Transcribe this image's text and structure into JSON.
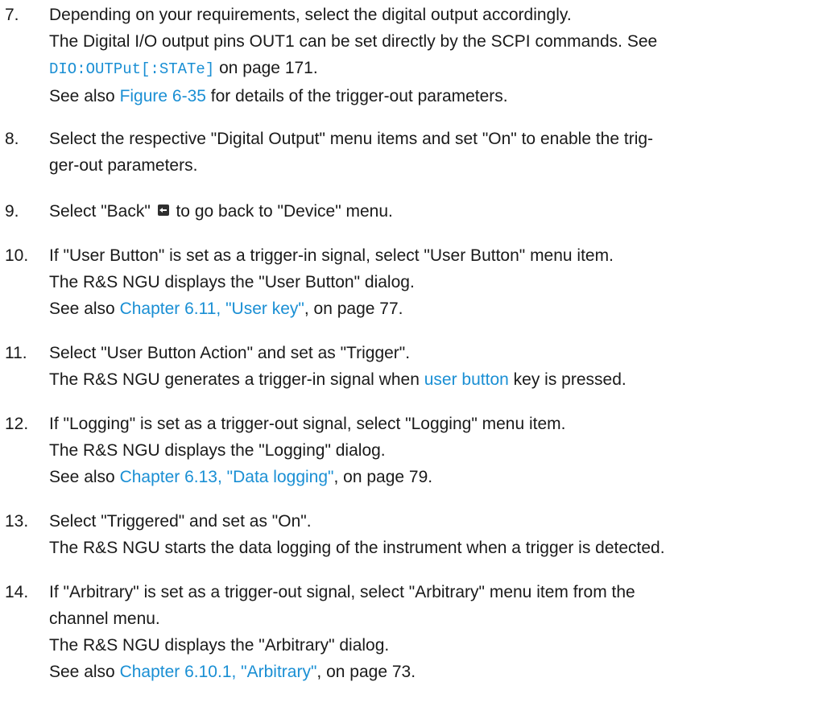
{
  "steps": [
    {
      "number": "7.",
      "lines": [
        {
          "text": "Depending on your requirements, select the digital output accordingly."
        },
        {
          "text": "The Digital I/O output pins OUT1 can be set directly by the SCPI commands. See"
        },
        {
          "link": "DIO:OUTPut[:STATe]",
          "after": " on page 171."
        },
        {
          "before": "See also ",
          "link": "Figure 6-35",
          "after": " for details of the trigger-out parameters."
        }
      ]
    },
    {
      "number": "8.",
      "lines": [
        {
          "text": "Select the respective \"Digital Output\" menu items and set \"On\" to enable the trig-"
        },
        {
          "text": "ger-out parameters."
        }
      ]
    },
    {
      "number": "9.",
      "lines": [
        {
          "before": "Select \"Back\" ",
          "icon": "back-arrow-icon",
          "after": " to go back to \"Device\" menu."
        }
      ]
    },
    {
      "number": "10.",
      "lines": [
        {
          "text": "If \"User Button\" is set as a trigger-in signal, select \"User Button\" menu item."
        },
        {
          "text": "The R&S NGU displays the \"User Button\" dialog."
        },
        {
          "before": "See also ",
          "link": "Chapter 6.11, \"User key\"",
          "after": ", on page 77."
        }
      ]
    },
    {
      "number": "11.",
      "lines": [
        {
          "text": "Select \"User Button Action\" and set as \"Trigger\"."
        },
        {
          "before": "The R&S NGU generates a trigger-in signal when ",
          "link": "user button",
          "after": " key is pressed."
        }
      ]
    },
    {
      "number": "12.",
      "lines": [
        {
          "text": "If \"Logging\" is set as a trigger-out signal, select \"Logging\" menu item."
        },
        {
          "text": "The R&S NGU displays the \"Logging\" dialog."
        },
        {
          "before": "See also ",
          "link": "Chapter 6.13, \"Data logging\"",
          "after": ", on page 79."
        }
      ]
    },
    {
      "number": "13.",
      "lines": [
        {
          "text": "Select \"Triggered\" and set as \"On\"."
        },
        {
          "text": "The R&S NGU starts the data logging of the instrument when a trigger is detected."
        }
      ]
    },
    {
      "number": "14.",
      "lines": [
        {
          "text": "If \"Arbitrary\" is set as a trigger-out signal, select \"Arbitrary\" menu item from the"
        },
        {
          "text": "channel menu."
        },
        {
          "text": "The R&S NGU displays the \"Arbitrary\" dialog."
        },
        {
          "before": "See also ",
          "link": "Chapter 6.10.1, \"Arbitrary\"",
          "after": ", on page 73."
        }
      ]
    }
  ]
}
